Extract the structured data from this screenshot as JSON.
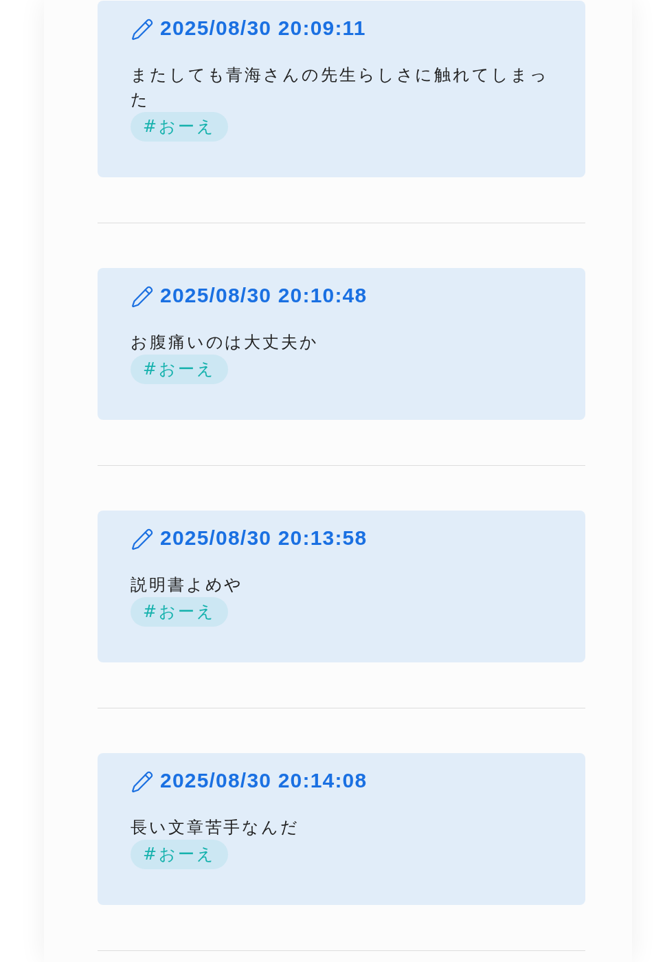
{
  "posts": [
    {
      "timestamp": "2025/08/30 20:09:11",
      "body": "またしても青海さんの先生らしさに触れてしまった",
      "tags": [
        "#おーえ"
      ]
    },
    {
      "timestamp": "2025/08/30 20:10:48",
      "body": "お腹痛いのは大丈夫か",
      "tags": [
        "#おーえ"
      ]
    },
    {
      "timestamp": "2025/08/30 20:13:58",
      "body": "説明書よめや",
      "tags": [
        "#おーえ"
      ]
    },
    {
      "timestamp": "2025/08/30 20:14:08",
      "body": "長い文章苦手なんだ",
      "tags": [
        "#おーえ"
      ]
    }
  ]
}
